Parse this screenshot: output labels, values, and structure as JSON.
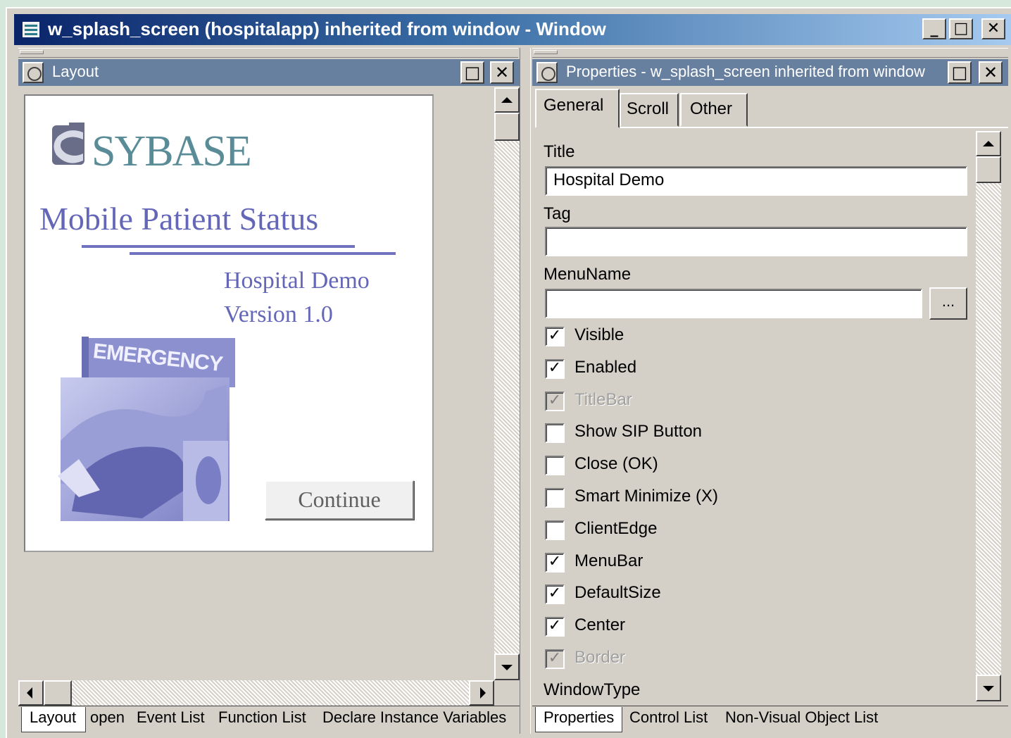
{
  "window": {
    "title": "w_splash_screen (hospitalapp) inherited from window - Window",
    "buttons": {
      "minimize": "_",
      "maximize": "□",
      "close": "✕"
    }
  },
  "layout_pane": {
    "title": "Layout",
    "canvas": {
      "logo_text": "SYBASE",
      "app_title": "Mobile Patient Status",
      "subtitle": "Hospital Demo",
      "version": "Version 1.0",
      "image_sign": "EMERGENCY",
      "continue_button": "Continue"
    },
    "bottom_tabs": [
      "Layout",
      "open",
      "Event List",
      "Function List",
      "Declare Instance Variables"
    ]
  },
  "properties_pane": {
    "title": "Properties - w_splash_screen inherited from window",
    "tabs": [
      "General",
      "Scroll",
      "Other"
    ],
    "fields": {
      "title_label": "Title",
      "title_value": "Hospital Demo",
      "tag_label": "Tag",
      "tag_value": "",
      "menuname_label": "MenuName",
      "menuname_value": "",
      "browse_button": "...",
      "windowtype_label": "WindowType"
    },
    "checkboxes": [
      {
        "label": "Visible",
        "checked": true,
        "disabled": false
      },
      {
        "label": "Enabled",
        "checked": true,
        "disabled": false
      },
      {
        "label": "TitleBar",
        "checked": true,
        "disabled": true
      },
      {
        "label": "Show SIP Button",
        "checked": false,
        "disabled": false
      },
      {
        "label": "Close (OK)",
        "checked": false,
        "disabled": false
      },
      {
        "label": "Smart Minimize (X)",
        "checked": false,
        "disabled": false
      },
      {
        "label": "ClientEdge",
        "checked": false,
        "disabled": false
      },
      {
        "label": "MenuBar",
        "checked": true,
        "disabled": false
      },
      {
        "label": "DefaultSize",
        "checked": true,
        "disabled": false
      },
      {
        "label": "Center",
        "checked": true,
        "disabled": false
      },
      {
        "label": "Border",
        "checked": true,
        "disabled": true
      }
    ],
    "bottom_tabs": [
      "Properties",
      "Control List",
      "Non-Visual Object List"
    ]
  },
  "colors": {
    "title_gradient_start": "#0a246a",
    "pane_title": "#6880a0",
    "sybase_teal": "#5a8c98",
    "splash_text": "#6466b8"
  },
  "icons": [
    "window-app-icon",
    "minimize-icon",
    "maximize-icon",
    "close-icon",
    "pane-icon",
    "scroll-up-icon",
    "scroll-down-icon",
    "scroll-left-icon",
    "scroll-right-icon",
    "checkmark-icon"
  ]
}
